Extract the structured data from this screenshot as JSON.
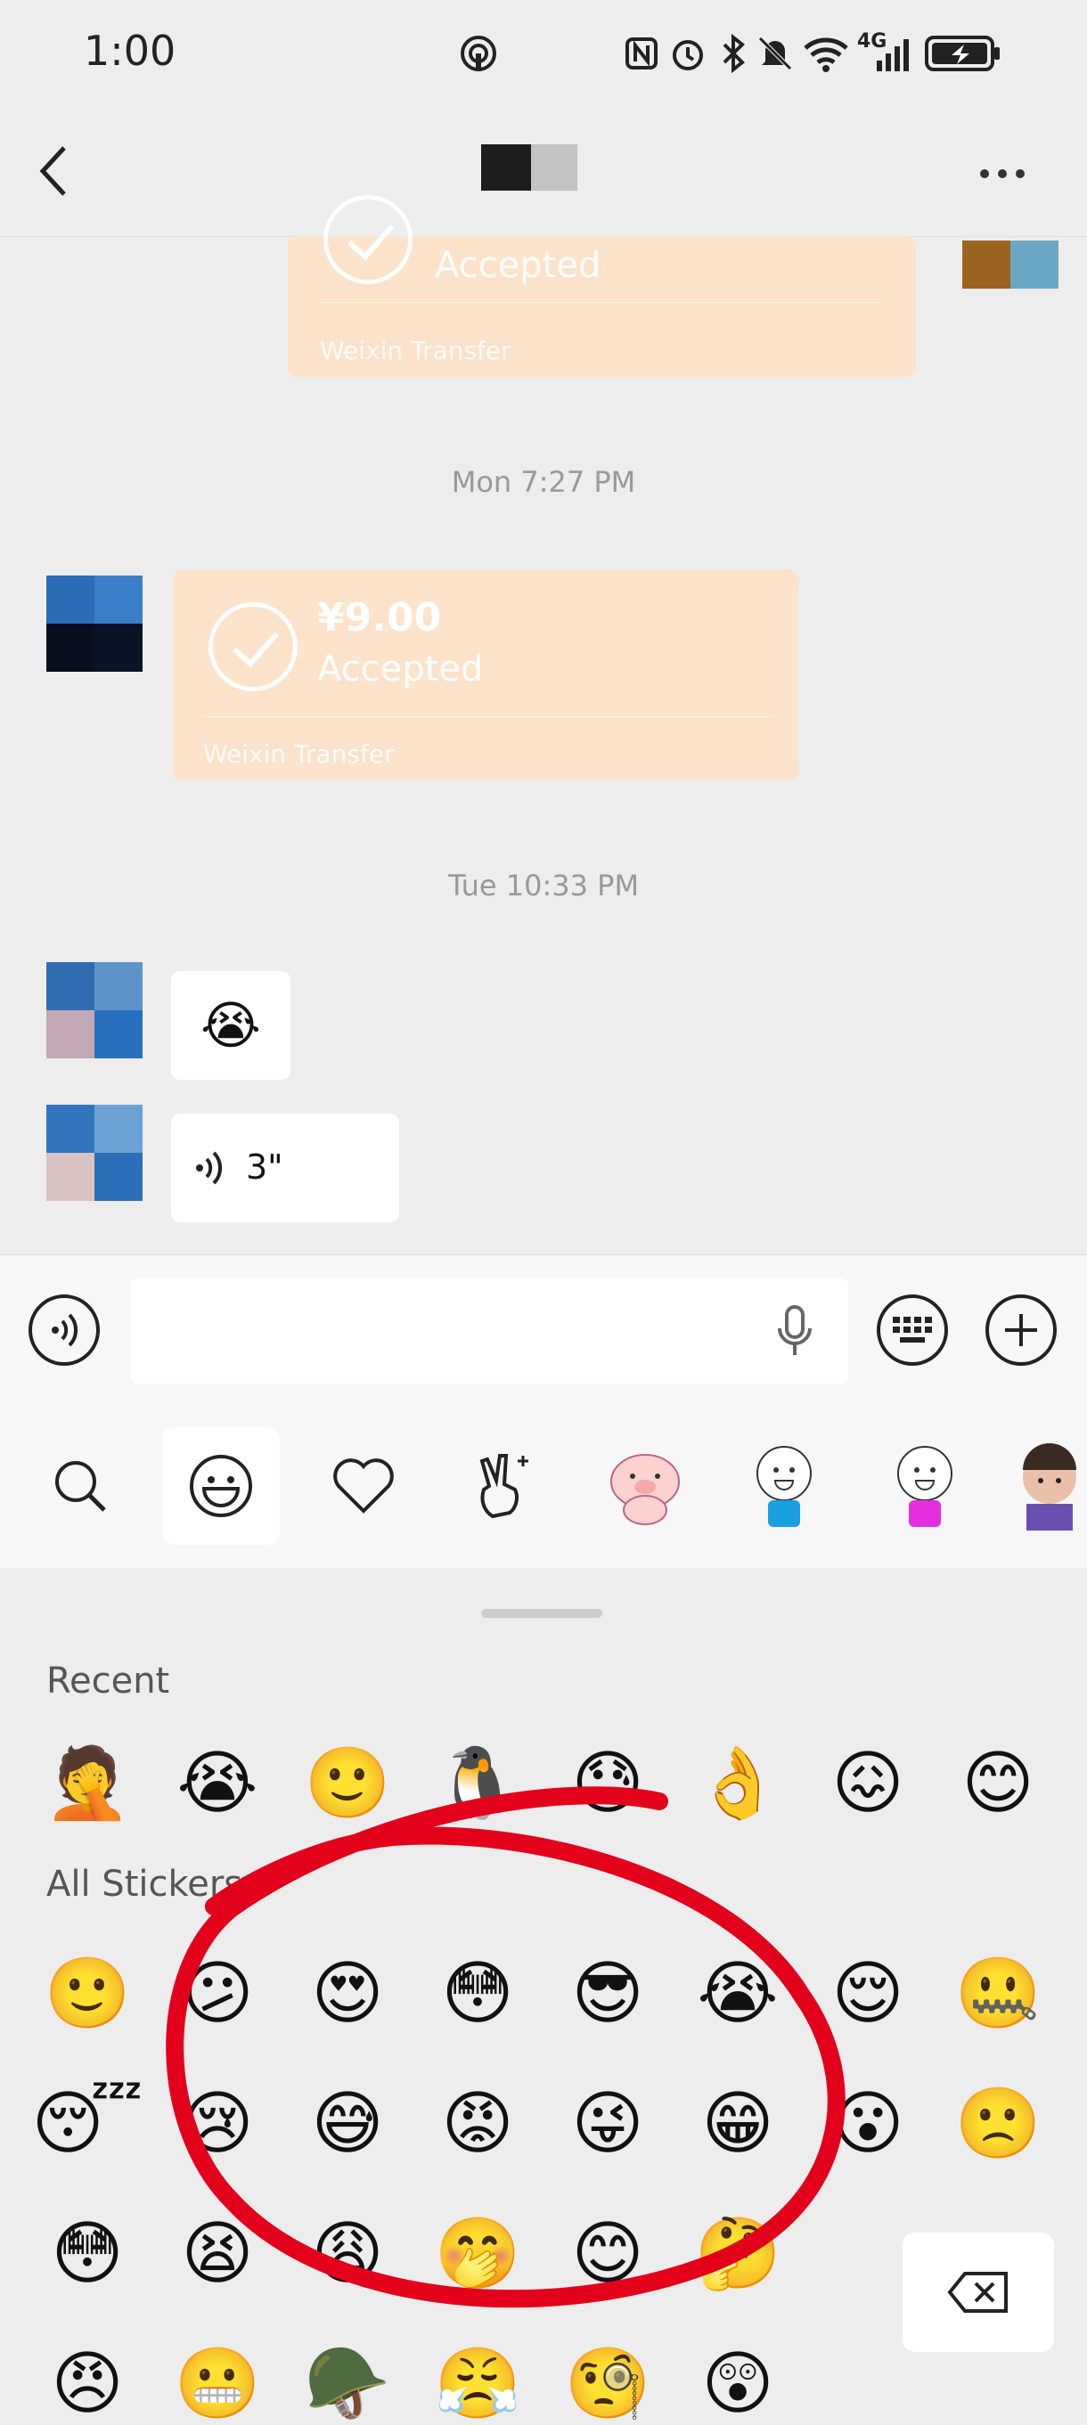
{
  "status_bar": {
    "time": "1:00",
    "icons": [
      "hotspot-icon",
      "nfc-icon",
      "alarm-icon",
      "bluetooth-icon",
      "mute-icon",
      "wifi-icon",
      "signal-4g-icon",
      "battery-charging-icon"
    ],
    "network_label": "4G"
  },
  "header": {
    "back_icon": "chevron-left-icon",
    "more_icon": "more-dots-icon"
  },
  "messages": {
    "transfer_top": {
      "status": "Accepted",
      "label": "Weixin Transfer"
    },
    "timestamp_1": "Mon 7:27 PM",
    "transfer_main": {
      "amount": "¥9.00",
      "status": "Accepted",
      "label": "Weixin Transfer"
    },
    "timestamp_2": "Tue 10:33 PM",
    "emoji_msg": "😭",
    "voice_msg": {
      "duration": "3\""
    }
  },
  "input_bar": {
    "voice_toggle_icon": "voice-wave-icon",
    "mic_icon": "microphone-icon",
    "keyboard_icon": "keyboard-icon",
    "plus_icon": "plus-icon"
  },
  "sticker_tabs": [
    "search-icon",
    "emoji-icon",
    "heart-icon",
    "hand-icon",
    "pig-sticker",
    "blue-figure-sticker",
    "pink-figure-sticker",
    "baby-sticker"
  ],
  "panel": {
    "recent_label": "Recent",
    "recent": [
      "🤦",
      "😭",
      "🙂",
      "🐧",
      "😓",
      "👌",
      "😖",
      "😊"
    ],
    "all_label": "All Stickers",
    "all_rows": [
      [
        "🙂",
        "😕",
        "😍",
        "😳",
        "😎",
        "😭",
        "😌",
        "🤐"
      ],
      [
        "😴",
        "😢",
        "😅",
        "😡",
        "😜",
        "😁",
        "😮",
        "🙁"
      ],
      [
        "😳",
        "😫",
        "😩",
        "🤭",
        "😊",
        "🤔"
      ],
      [
        "😠",
        "😬",
        "🪖",
        "😤",
        "🧐",
        "😲"
      ]
    ],
    "delete_icon": "backspace-icon"
  },
  "colors": {
    "background": "#ededed",
    "transfer_orange": "#fde3c8",
    "annotation_red": "#e3001b"
  }
}
